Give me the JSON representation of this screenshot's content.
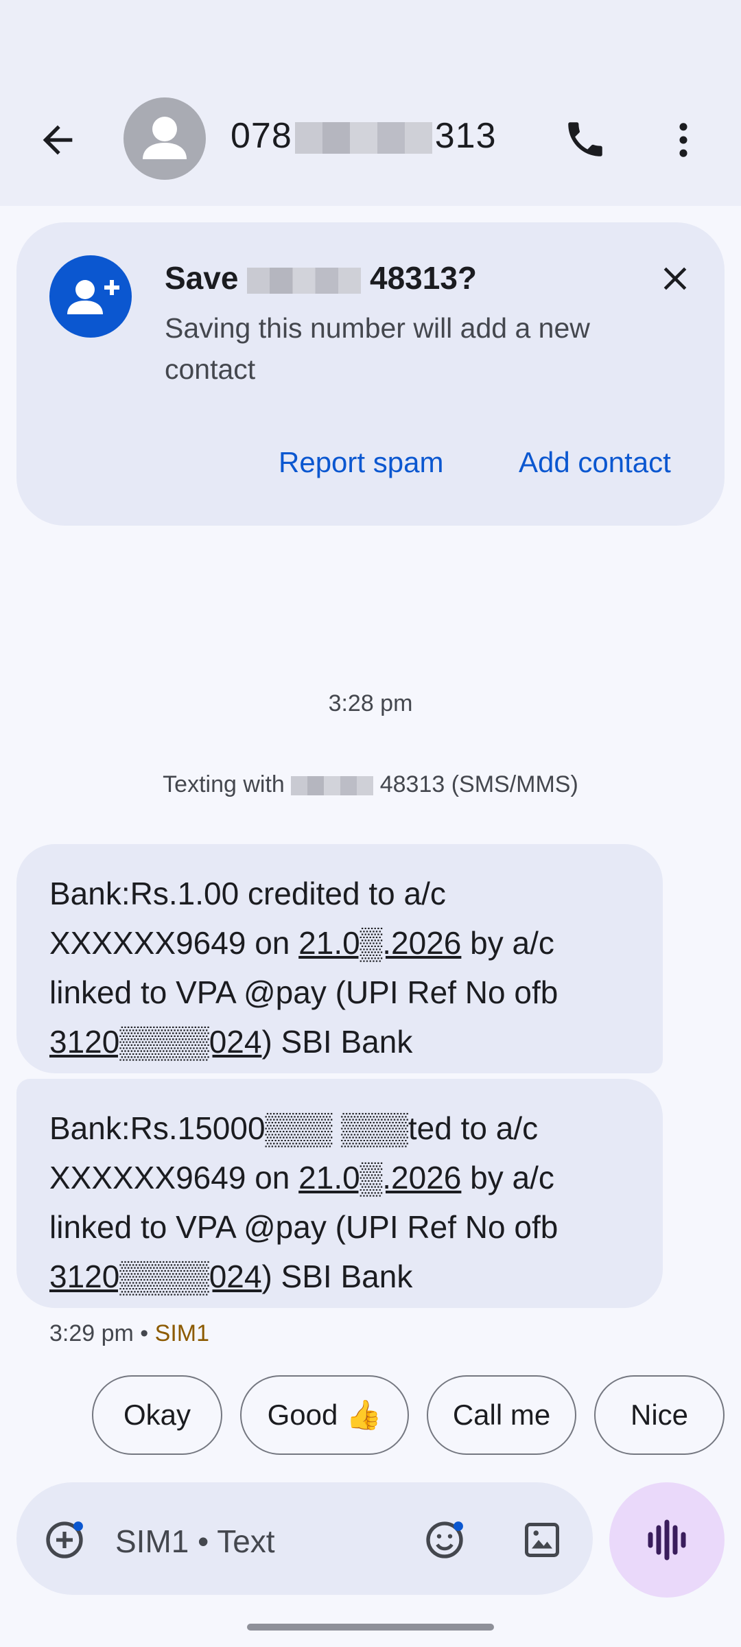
{
  "header": {
    "title_prefix": "078",
    "title_suffix": "313"
  },
  "save_card": {
    "title_prefix": "Save",
    "title_suffix": "48313?",
    "subtitle": "Saving this number will add a new contact",
    "report_spam_label": "Report spam",
    "add_contact_label": "Add contact"
  },
  "conversation": {
    "timestamp": "3:28 pm",
    "texting_with_prefix": "Texting with",
    "texting_with_suffix": "48313 (SMS/MMS)",
    "messages": [
      {
        "part1": "Bank:Rs.1.00 credited to a/c XXXXXX9649 on ",
        "date": "21.0▒.2026",
        "part2": " by a/c linked to VPA @pay (UPI Ref No ofb ",
        "ref": "3120▒▒▒▒024",
        "part3": ") SBI Bank"
      },
      {
        "part1": "Bank:Rs.15000▒▒▒ ▒▒▒ted to a/c XXXXXX9649 on ",
        "date": "21.0▒.2026",
        "part2": " by a/c linked to VPA @pay (UPI Ref No ofb ",
        "ref": "3120▒▒▒▒024",
        "part3": ") SBI Bank"
      }
    ],
    "meta_time": "3:29 pm",
    "meta_sep": " • ",
    "meta_sim": "SIM1"
  },
  "smart_replies": [
    "Okay",
    "Good 👍",
    "Call me",
    "Nice"
  ],
  "compose": {
    "placeholder": "SIM1 • Text"
  },
  "colors": {
    "accent": "#0b57d0",
    "bubble": "#e6e9f6",
    "voice_button": "#ead9fa",
    "sim_label": "#8c5a00"
  },
  "icons": [
    "back-arrow-icon",
    "avatar-person-icon",
    "phone-icon",
    "more-vert-icon",
    "add-person-icon",
    "close-icon",
    "add-circle-icon",
    "emoji-icon",
    "gallery-icon",
    "voice-waveform-icon"
  ]
}
